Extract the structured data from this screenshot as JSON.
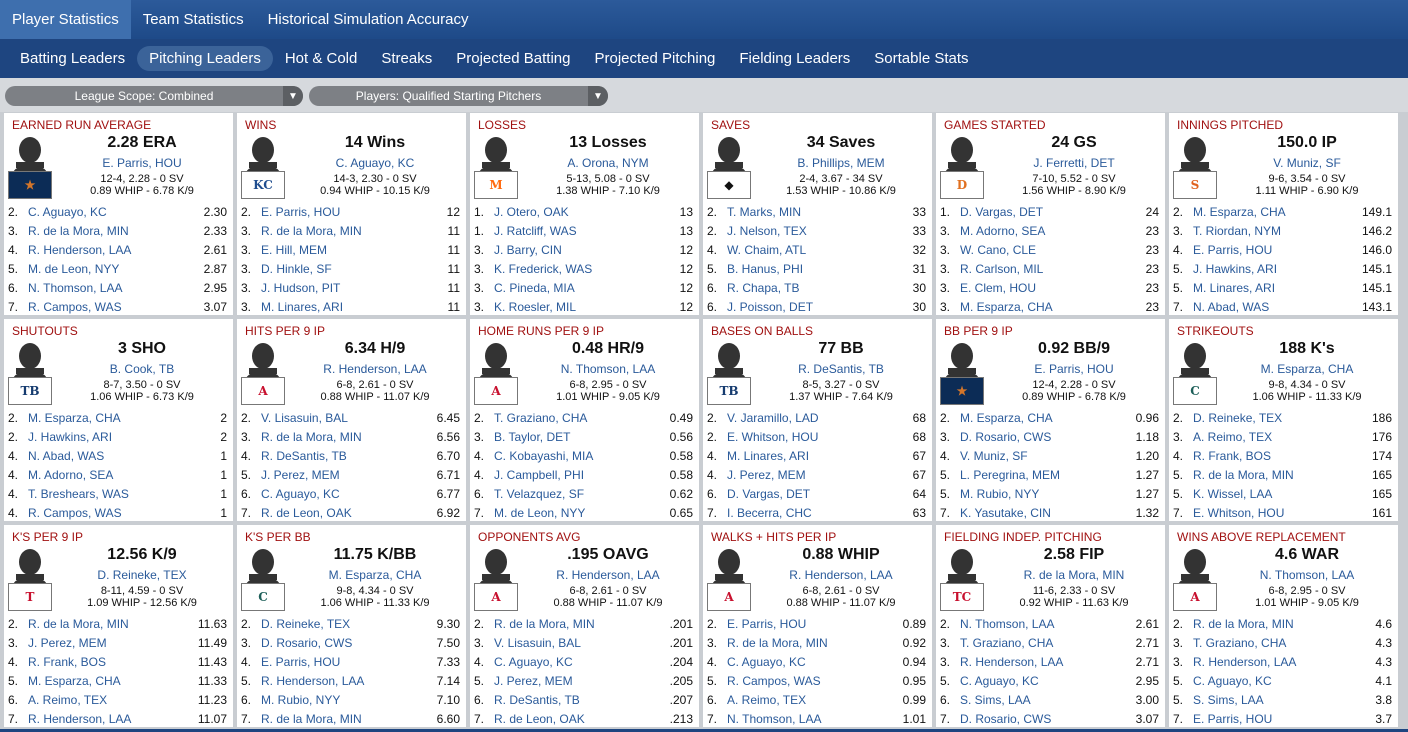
{
  "top_tabs": [
    {
      "label": "Player Statistics",
      "active": true
    },
    {
      "label": "Team Statistics",
      "active": false
    },
    {
      "label": "Historical Simulation Accuracy",
      "active": false
    }
  ],
  "sub_tabs": [
    {
      "label": "Batting Leaders",
      "active": false
    },
    {
      "label": "Pitching Leaders",
      "active": true
    },
    {
      "label": "Hot & Cold",
      "active": false
    },
    {
      "label": "Streaks",
      "active": false
    },
    {
      "label": "Projected Batting",
      "active": false
    },
    {
      "label": "Projected Pitching",
      "active": false
    },
    {
      "label": "Fielding Leaders",
      "active": false
    },
    {
      "label": "Sortable Stats",
      "active": false
    }
  ],
  "filters": {
    "scope": "League Scope: Combined",
    "players": "Players: Qualified Starting Pitchers"
  },
  "cards": [
    {
      "title": "EARNED RUN AVERAGE",
      "value": "2.28 ERA",
      "leader": "E. Parris, HOU",
      "line1": "12-4, 2.28 - 0 SV",
      "line2": "0.89 WHIP - 6.78 K/9",
      "logo": "astros",
      "rows": [
        [
          "2.",
          "C. Aguayo, KC",
          "2.30"
        ],
        [
          "3.",
          "R. de la Mora, MIN",
          "2.33"
        ],
        [
          "4.",
          "R. Henderson, LAA",
          "2.61"
        ],
        [
          "5.",
          "M. de Leon, NYY",
          "2.87"
        ],
        [
          "6.",
          "N. Thomson, LAA",
          "2.95"
        ],
        [
          "7.",
          "R. Campos, WAS",
          "3.07"
        ]
      ]
    },
    {
      "title": "WINS",
      "value": "14 Wins",
      "leader": "C. Aguayo, KC",
      "line1": "14-3, 2.30 - 0 SV",
      "line2": "0.94 WHIP - 10.15 K/9",
      "logo": "royals",
      "rows": [
        [
          "2.",
          "E. Parris, HOU",
          "12"
        ],
        [
          "3.",
          "R. de la Mora, MIN",
          "11"
        ],
        [
          "3.",
          "E. Hill, MEM",
          "11"
        ],
        [
          "3.",
          "D. Hinkle, SF",
          "11"
        ],
        [
          "3.",
          "J. Hudson, PIT",
          "11"
        ],
        [
          "3.",
          "M. Linares, ARI",
          "11"
        ]
      ]
    },
    {
      "title": "LOSSES",
      "value": "13 Losses",
      "leader": "A. Orona, NYM",
      "line1": "5-13, 5.08 - 0 SV",
      "line2": "1.38 WHIP - 7.10 K/9",
      "logo": "mets",
      "rows": [
        [
          "1.",
          "J. Otero, OAK",
          "13"
        ],
        [
          "1.",
          "J. Ratcliff, WAS",
          "13"
        ],
        [
          "3.",
          "J. Barry, CIN",
          "12"
        ],
        [
          "3.",
          "K. Frederick, WAS",
          "12"
        ],
        [
          "3.",
          "C. Pineda, MIA",
          "12"
        ],
        [
          "3.",
          "K. Roesler, MIL",
          "12"
        ]
      ]
    },
    {
      "title": "SAVES",
      "value": "34 Saves",
      "leader": "B. Phillips, MEM",
      "line1": "2-4, 3.67 - 34 SV",
      "line2": "1.53 WHIP - 10.86 K/9",
      "logo": "memphis",
      "rows": [
        [
          "2.",
          "T. Marks, MIN",
          "33"
        ],
        [
          "2.",
          "J. Nelson, TEX",
          "33"
        ],
        [
          "4.",
          "W. Chaim, ATL",
          "32"
        ],
        [
          "5.",
          "B. Hanus, PHI",
          "31"
        ],
        [
          "6.",
          "R. Chapa, TB",
          "30"
        ],
        [
          "6.",
          "J. Poisson, DET",
          "30"
        ]
      ]
    },
    {
      "title": "GAMES STARTED",
      "value": "24 GS",
      "leader": "J. Ferretti, DET",
      "line1": "7-10, 5.52 - 0 SV",
      "line2": "1.56 WHIP - 8.90 K/9",
      "logo": "tigers",
      "rows": [
        [
          "1.",
          "D. Vargas, DET",
          "24"
        ],
        [
          "3.",
          "M. Adorno, SEA",
          "23"
        ],
        [
          "3.",
          "W. Cano, CLE",
          "23"
        ],
        [
          "3.",
          "R. Carlson, MIL",
          "23"
        ],
        [
          "3.",
          "E. Clem, HOU",
          "23"
        ],
        [
          "3.",
          "M. Esparza, CHA",
          "23"
        ]
      ]
    },
    {
      "title": "INNINGS PITCHED",
      "value": "150.0 IP",
      "leader": "V. Muniz, SF",
      "line1": "9-6, 3.54 - 0 SV",
      "line2": "1.11 WHIP - 6.90 K/9",
      "logo": "giants",
      "rows": [
        [
          "2.",
          "M. Esparza, CHA",
          "149.1"
        ],
        [
          "3.",
          "T. Riordan, NYM",
          "146.2"
        ],
        [
          "4.",
          "E. Parris, HOU",
          "146.0"
        ],
        [
          "5.",
          "J. Hawkins, ARI",
          "145.1"
        ],
        [
          "5.",
          "M. Linares, ARI",
          "145.1"
        ],
        [
          "7.",
          "N. Abad, WAS",
          "143.1"
        ]
      ]
    },
    {
      "title": "SHUTOUTS",
      "value": "3 SHO",
      "leader": "B. Cook, TB",
      "line1": "8-7, 3.50 - 0 SV",
      "line2": "1.06 WHIP - 6.73 K/9",
      "logo": "rays",
      "rows": [
        [
          "2.",
          "M. Esparza, CHA",
          "2"
        ],
        [
          "2.",
          "J. Hawkins, ARI",
          "2"
        ],
        [
          "4.",
          "N. Abad, WAS",
          "1"
        ],
        [
          "4.",
          "M. Adorno, SEA",
          "1"
        ],
        [
          "4.",
          "T. Breshears, WAS",
          "1"
        ],
        [
          "4.",
          "R. Campos, WAS",
          "1"
        ]
      ]
    },
    {
      "title": "HITS PER 9 IP",
      "value": "6.34 H/9",
      "leader": "R. Henderson, LAA",
      "line1": "6-8, 2.61 - 0 SV",
      "line2": "0.88 WHIP - 11.07 K/9",
      "logo": "angels",
      "rows": [
        [
          "2.",
          "V. Lisasuin, BAL",
          "6.45"
        ],
        [
          "3.",
          "R. de la Mora, MIN",
          "6.56"
        ],
        [
          "4.",
          "R. DeSantis, TB",
          "6.70"
        ],
        [
          "5.",
          "J. Perez, MEM",
          "6.71"
        ],
        [
          "6.",
          "C. Aguayo, KC",
          "6.77"
        ],
        [
          "7.",
          "R. de Leon, OAK",
          "6.92"
        ]
      ]
    },
    {
      "title": "HOME RUNS PER 9 IP",
      "value": "0.48 HR/9",
      "leader": "N. Thomson, LAA",
      "line1": "6-8, 2.95 - 0 SV",
      "line2": "1.01 WHIP - 9.05 K/9",
      "logo": "angels",
      "rows": [
        [
          "2.",
          "T. Graziano, CHA",
          "0.49"
        ],
        [
          "3.",
          "B. Taylor, DET",
          "0.56"
        ],
        [
          "4.",
          "C. Kobayashi, MIA",
          "0.58"
        ],
        [
          "4.",
          "J. Campbell, PHI",
          "0.58"
        ],
        [
          "6.",
          "T. Velazquez, SF",
          "0.62"
        ],
        [
          "7.",
          "M. de Leon, NYY",
          "0.65"
        ]
      ]
    },
    {
      "title": "BASES ON BALLS",
      "value": "77 BB",
      "leader": "R. DeSantis, TB",
      "line1": "8-5, 3.27 - 0 SV",
      "line2": "1.37 WHIP - 7.64 K/9",
      "logo": "rays",
      "rows": [
        [
          "2.",
          "V. Jaramillo, LAD",
          "68"
        ],
        [
          "2.",
          "E. Whitson, HOU",
          "68"
        ],
        [
          "4.",
          "M. Linares, ARI",
          "67"
        ],
        [
          "4.",
          "J. Perez, MEM",
          "67"
        ],
        [
          "6.",
          "D. Vargas, DET",
          "64"
        ],
        [
          "7.",
          "I. Becerra, CHC",
          "63"
        ]
      ]
    },
    {
      "title": "BB PER 9 IP",
      "value": "0.92 BB/9",
      "leader": "E. Parris, HOU",
      "line1": "12-4, 2.28 - 0 SV",
      "line2": "0.89 WHIP - 6.78 K/9",
      "logo": "astros",
      "rows": [
        [
          "2.",
          "M. Esparza, CHA",
          "0.96"
        ],
        [
          "3.",
          "D. Rosario, CWS",
          "1.18"
        ],
        [
          "4.",
          "V. Muniz, SF",
          "1.20"
        ],
        [
          "5.",
          "L. Peregrina, MEM",
          "1.27"
        ],
        [
          "5.",
          "M. Rubio, NYY",
          "1.27"
        ],
        [
          "7.",
          "K. Yasutake, CIN",
          "1.32"
        ]
      ]
    },
    {
      "title": "STRIKEOUTS",
      "value": "188 K's",
      "leader": "M. Esparza, CHA",
      "line1": "9-8, 4.34 - 0 SV",
      "line2": "1.06 WHIP - 11.33 K/9",
      "logo": "chicago",
      "rows": [
        [
          "2.",
          "D. Reineke, TEX",
          "186"
        ],
        [
          "3.",
          "A. Reimo, TEX",
          "176"
        ],
        [
          "4.",
          "R. Frank, BOS",
          "174"
        ],
        [
          "5.",
          "R. de la Mora, MIN",
          "165"
        ],
        [
          "5.",
          "K. Wissel, LAA",
          "165"
        ],
        [
          "7.",
          "E. Whitson, HOU",
          "161"
        ]
      ]
    },
    {
      "title": "K'S PER 9 IP",
      "value": "12.56 K/9",
      "leader": "D. Reineke, TEX",
      "line1": "8-11, 4.59 - 0 SV",
      "line2": "1.09 WHIP - 12.56 K/9",
      "logo": "rangers",
      "rows": [
        [
          "2.",
          "R. de la Mora, MIN",
          "11.63"
        ],
        [
          "3.",
          "J. Perez, MEM",
          "11.49"
        ],
        [
          "4.",
          "R. Frank, BOS",
          "11.43"
        ],
        [
          "5.",
          "M. Esparza, CHA",
          "11.33"
        ],
        [
          "6.",
          "A. Reimo, TEX",
          "11.23"
        ],
        [
          "7.",
          "R. Henderson, LAA",
          "11.07"
        ]
      ]
    },
    {
      "title": "K'S PER BB",
      "value": "11.75 K/BB",
      "leader": "M. Esparza, CHA",
      "line1": "9-8, 4.34 - 0 SV",
      "line2": "1.06 WHIP - 11.33 K/9",
      "logo": "chicago",
      "rows": [
        [
          "2.",
          "D. Reineke, TEX",
          "9.30"
        ],
        [
          "3.",
          "D. Rosario, CWS",
          "7.50"
        ],
        [
          "4.",
          "E. Parris, HOU",
          "7.33"
        ],
        [
          "5.",
          "R. Henderson, LAA",
          "7.14"
        ],
        [
          "6.",
          "M. Rubio, NYY",
          "7.10"
        ],
        [
          "7.",
          "R. de la Mora, MIN",
          "6.60"
        ]
      ]
    },
    {
      "title": "OPPONENTS AVG",
      "value": ".195 OAVG",
      "leader": "R. Henderson, LAA",
      "line1": "6-8, 2.61 - 0 SV",
      "line2": "0.88 WHIP - 11.07 K/9",
      "logo": "angels",
      "rows": [
        [
          "2.",
          "R. de la Mora, MIN",
          ".201"
        ],
        [
          "3.",
          "V. Lisasuin, BAL",
          ".201"
        ],
        [
          "4.",
          "C. Aguayo, KC",
          ".204"
        ],
        [
          "5.",
          "J. Perez, MEM",
          ".205"
        ],
        [
          "6.",
          "R. DeSantis, TB",
          ".207"
        ],
        [
          "7.",
          "R. de Leon, OAK",
          ".213"
        ]
      ]
    },
    {
      "title": "WALKS + HITS PER IP",
      "value": "0.88 WHIP",
      "leader": "R. Henderson, LAA",
      "line1": "6-8, 2.61 - 0 SV",
      "line2": "0.88 WHIP - 11.07 K/9",
      "logo": "angels",
      "rows": [
        [
          "2.",
          "E. Parris, HOU",
          "0.89"
        ],
        [
          "3.",
          "R. de la Mora, MIN",
          "0.92"
        ],
        [
          "4.",
          "C. Aguayo, KC",
          "0.94"
        ],
        [
          "5.",
          "R. Campos, WAS",
          "0.95"
        ],
        [
          "6.",
          "A. Reimo, TEX",
          "0.99"
        ],
        [
          "7.",
          "N. Thomson, LAA",
          "1.01"
        ]
      ]
    },
    {
      "title": "FIELDING INDEP. PITCHING",
      "value": "2.58 FIP",
      "leader": "R. de la Mora, MIN",
      "line1": "11-6, 2.33 - 0 SV",
      "line2": "0.92 WHIP - 11.63 K/9",
      "logo": "twins",
      "rows": [
        [
          "2.",
          "N. Thomson, LAA",
          "2.61"
        ],
        [
          "3.",
          "T. Graziano, CHA",
          "2.71"
        ],
        [
          "3.",
          "R. Henderson, LAA",
          "2.71"
        ],
        [
          "5.",
          "C. Aguayo, KC",
          "2.95"
        ],
        [
          "6.",
          "S. Sims, LAA",
          "3.00"
        ],
        [
          "7.",
          "D. Rosario, CWS",
          "3.07"
        ]
      ]
    },
    {
      "title": "WINS ABOVE REPLACEMENT",
      "value": "4.6 WAR",
      "leader": "N. Thomson, LAA",
      "line1": "6-8, 2.95 - 0 SV",
      "line2": "1.01 WHIP - 9.05 K/9",
      "logo": "angels",
      "rows": [
        [
          "2.",
          "R. de la Mora, MIN",
          "4.6"
        ],
        [
          "3.",
          "T. Graziano, CHA",
          "4.3"
        ],
        [
          "3.",
          "R. Henderson, LAA",
          "4.3"
        ],
        [
          "5.",
          "C. Aguayo, KC",
          "4.1"
        ],
        [
          "5.",
          "S. Sims, LAA",
          "3.8"
        ],
        [
          "7.",
          "E. Parris, HOU",
          "3.7"
        ]
      ]
    }
  ],
  "logos": {
    "astros": {
      "text": "★",
      "color": "#d4762a",
      "bg": "#0c2c56"
    },
    "royals": {
      "text": "KC",
      "color": "#1f4d8f",
      "bg": "#ffffff"
    },
    "mets": {
      "text": "M",
      "color": "#ff6a10",
      "bg": "#ffffff"
    },
    "memphis": {
      "text": "◆",
      "color": "#111111",
      "bg": "#ffffff"
    },
    "tigers": {
      "text": "D",
      "color": "#e07020",
      "bg": "#ffffff"
    },
    "giants": {
      "text": "S",
      "color": "#e0621f",
      "bg": "#ffffff"
    },
    "rays": {
      "text": "TB",
      "color": "#153b6f",
      "bg": "#ffffff"
    },
    "angels": {
      "text": "A",
      "color": "#c8102e",
      "bg": "#ffffff"
    },
    "chicago": {
      "text": "C",
      "color": "#1d5f59",
      "bg": "#ffffff"
    },
    "rangers": {
      "text": "T",
      "color": "#c8102e",
      "bg": "#ffffff"
    },
    "twins": {
      "text": "TC",
      "color": "#c8102e",
      "bg": "#ffffff"
    }
  }
}
